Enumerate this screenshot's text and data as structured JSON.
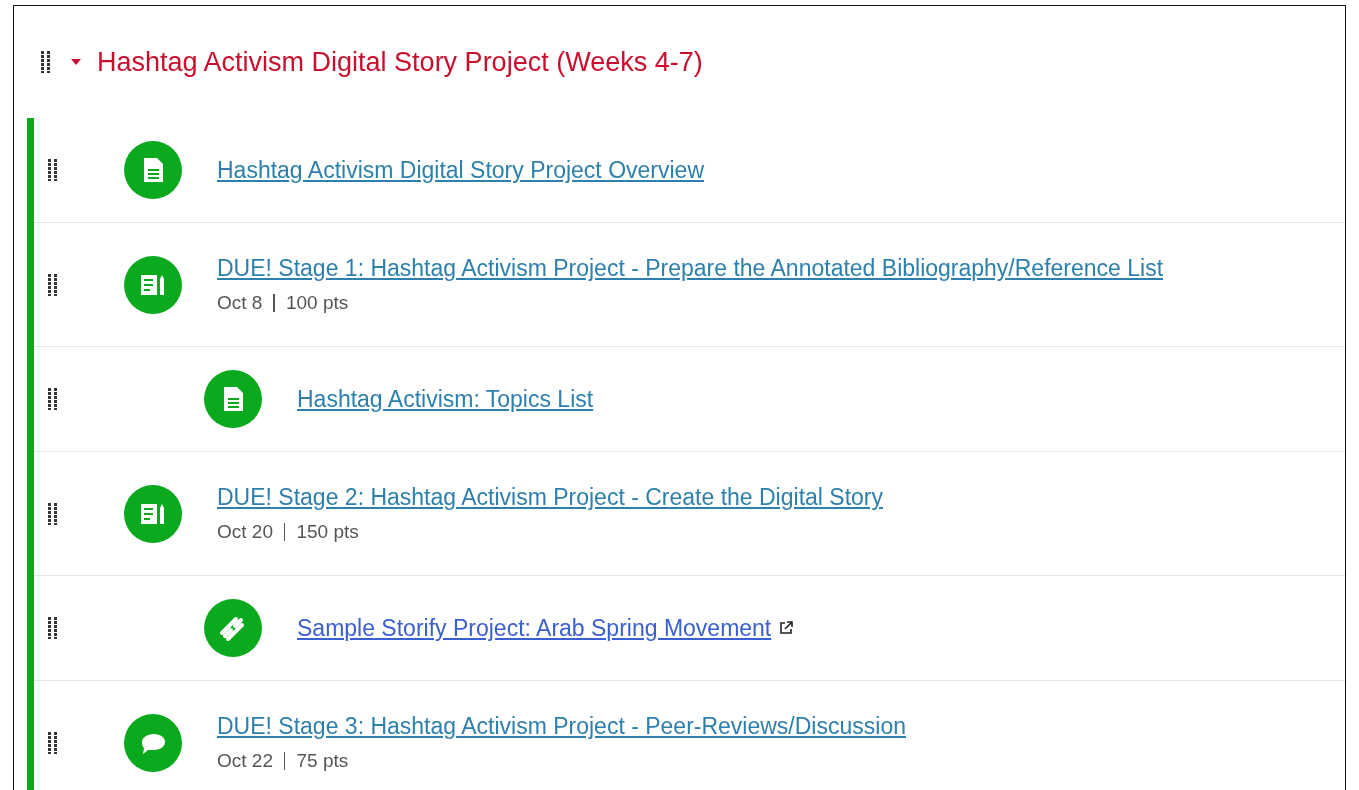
{
  "module": {
    "title": "Hashtag Activism Digital Story Project (Weeks 4-7)",
    "expanded": true,
    "items": [
      {
        "kind": "page",
        "title": "Hashtag Activism Digital Story Project Overview"
      },
      {
        "kind": "assignment",
        "title": "DUE! Stage 1: Hashtag Activism Project - Prepare the Annotated Bibliography/Reference List",
        "date": "Oct 8",
        "points": "100 pts",
        "children": [
          {
            "kind": "page",
            "title": "Hashtag Activism: Topics List"
          }
        ]
      },
      {
        "kind": "assignment",
        "title": "DUE! Stage 2: Hashtag Activism Project - Create the Digital Story",
        "date": "Oct 20",
        "points": "150 pts",
        "children": [
          {
            "kind": "external",
            "title": "Sample Storify Project: Arab Spring Movement"
          }
        ]
      },
      {
        "kind": "discussion",
        "title": "DUE! Stage 3: Hashtag Activism Project - Peer-Reviews/Discussion",
        "date": "Oct 22",
        "points": "75 pts"
      }
    ]
  }
}
